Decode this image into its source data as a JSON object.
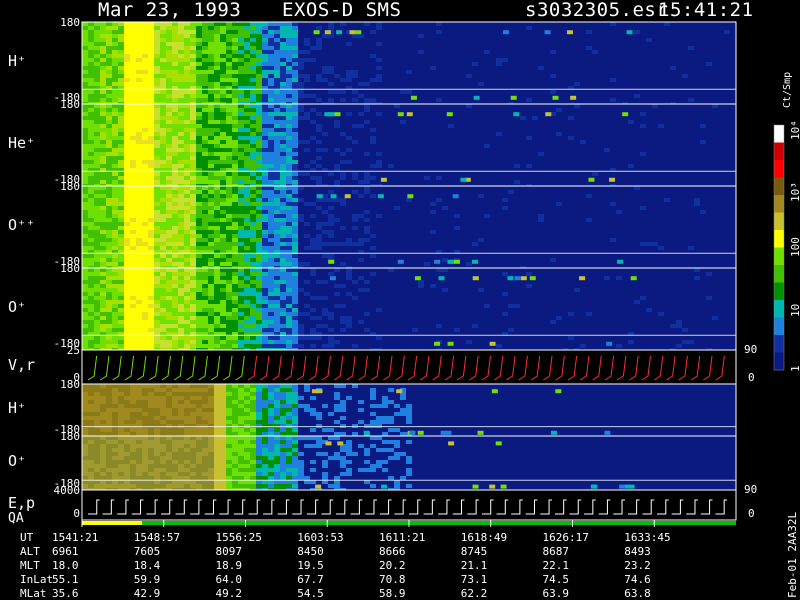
{
  "header": {
    "date": "Mar 23, 1993",
    "title": "EXOS-D SMS",
    "file": "s3032305.esr",
    "time": "15:41:21"
  },
  "colorbar": {
    "unit_label": "Ct/Smp",
    "tick_labels": [
      "10⁴",
      "10³",
      "100",
      "10",
      "1"
    ],
    "colors": [
      "#ffffff",
      "#cc0000",
      "#ff0000",
      "#7a5a10",
      "#a08a20",
      "#c8c030",
      "#ffff00",
      "#70e000",
      "#40c000",
      "#009000",
      "#00b8b0",
      "#2080e0",
      "#1030a0",
      "#0a1a80"
    ]
  },
  "chart_data": {
    "type": "heatmap",
    "title": "Mar 23, 1993   EXOS-D SMS",
    "time_labels": [
      "1541:21",
      "1548:57",
      "1556:25",
      "1603:53",
      "1611:21",
      "1618:49",
      "1626:17",
      "1633:45"
    ],
    "panels": [
      {
        "label": "H⁺",
        "y_top": "180",
        "y_bot": "-180"
      },
      {
        "label": "He⁺",
        "y_top": "180",
        "y_bot": "-180"
      },
      {
        "label": "O⁺⁺",
        "y_top": "180",
        "y_bot": "-180"
      },
      {
        "label": "O⁺",
        "y_top": "180",
        "y_bot": "-180",
        "right_top": "90"
      },
      {
        "label": "V,r",
        "y_top": "25",
        "y_bot": "0",
        "right_bot": "0"
      },
      {
        "label": "H⁺",
        "y_top": "180",
        "y_bot": "-180"
      },
      {
        "label": "O⁺",
        "y_top": "180",
        "y_bot": "-180",
        "right_top": "90"
      },
      {
        "label": "E,p",
        "y_top": "4000",
        "y_bot": "0",
        "right_bot": "0"
      }
    ],
    "qa_label": "QA",
    "table": {
      "rows": [
        {
          "name": "UT",
          "values": [
            "1541:21",
            "1548:57",
            "1556:25",
            "1603:53",
            "1611:21",
            "1618:49",
            "1626:17",
            "1633:45"
          ]
        },
        {
          "name": "ALT",
          "values": [
            "6961",
            "7605",
            "8097",
            "8450",
            "8666",
            "8745",
            "8687",
            "8493"
          ]
        },
        {
          "name": "MLT",
          "values": [
            "18.0",
            "18.4",
            "18.9",
            "19.5",
            "20.2",
            "21.1",
            "22.1",
            "23.2"
          ]
        },
        {
          "name": "InLat",
          "values": [
            "55.1",
            "59.9",
            "64.0",
            "67.7",
            "70.8",
            "73.1",
            "74.5",
            "74.6"
          ]
        },
        {
          "name": "MLat",
          "values": [
            "35.6",
            "42.9",
            "49.2",
            "54.5",
            "58.9",
            "62.2",
            "63.9",
            "63.8"
          ]
        }
      ]
    }
  },
  "footer": {
    "stamp": "Feb-01 2AA32L"
  }
}
